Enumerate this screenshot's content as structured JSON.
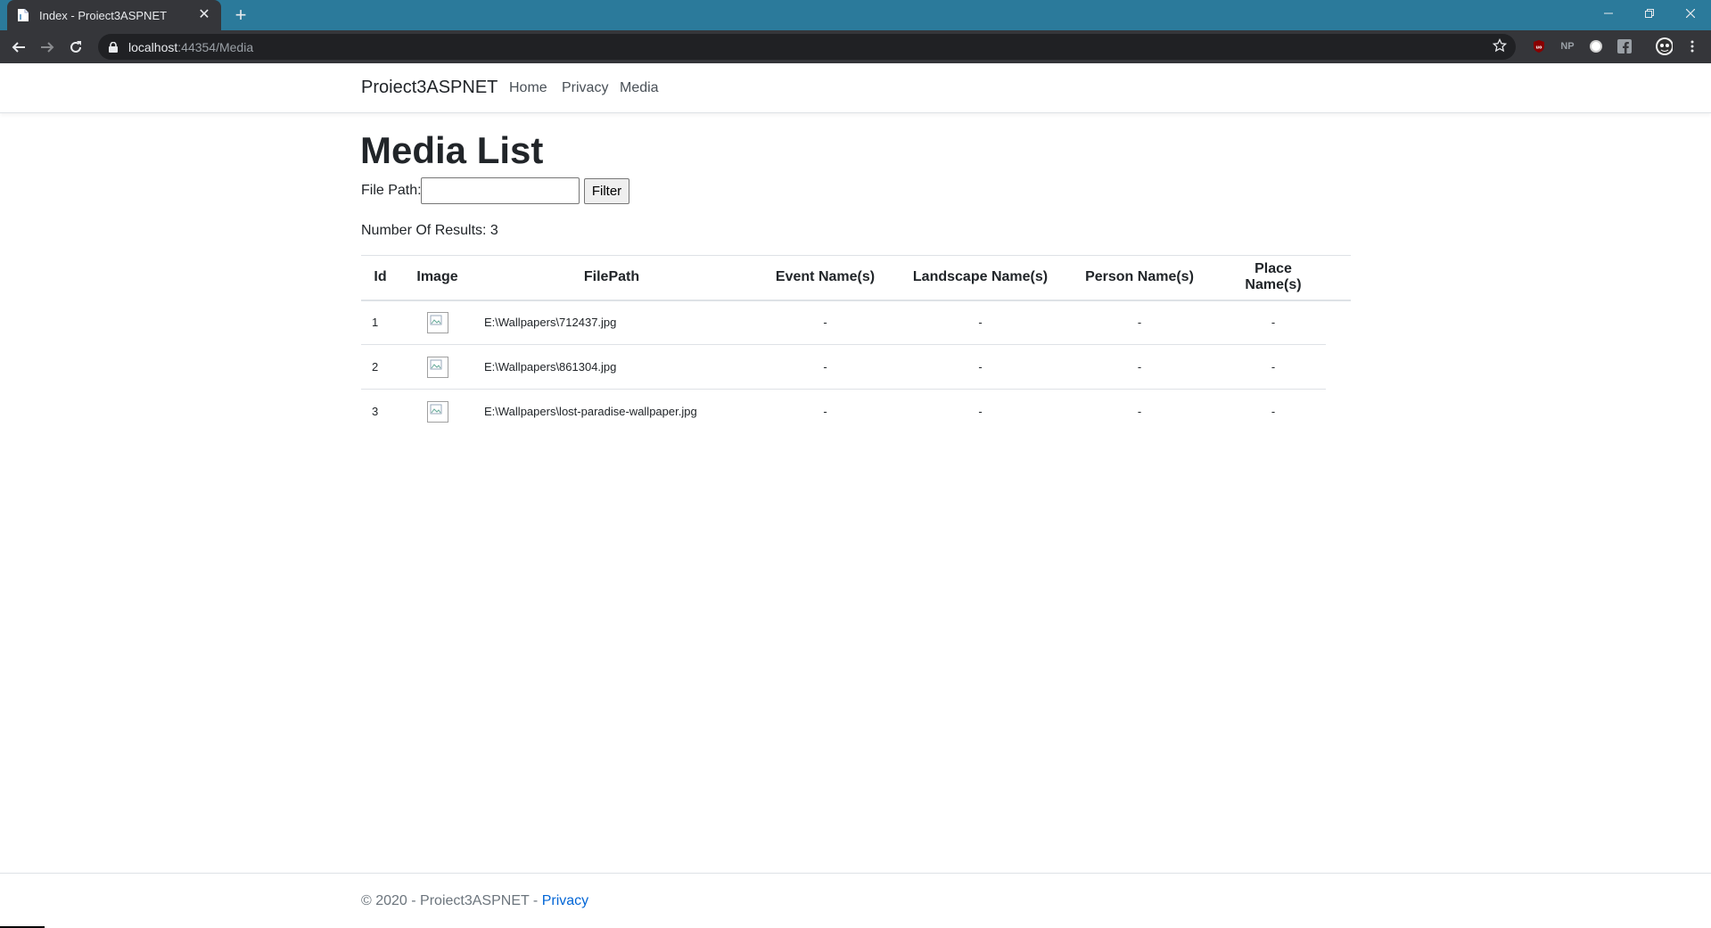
{
  "browser": {
    "tab_title": "Index - Proiect3ASPNET",
    "tab_close": "✕",
    "new_tab": "+",
    "url_host": "localhost",
    "url_rest": ":44354/Media",
    "extensions": [
      "ublock-icon",
      "np-icon",
      "circle-extension-icon",
      "facebook-icon",
      "profile-avatar"
    ],
    "ext_np_label": "NP"
  },
  "site": {
    "brand": "Proiect3ASPNET",
    "nav": [
      "Home",
      "Privacy",
      "Media"
    ]
  },
  "main": {
    "title": "Media List",
    "filter_label": "File Path:",
    "filter_value": "",
    "filter_button": "Filter",
    "results_text": "Number Of Results: 3"
  },
  "table": {
    "headers": [
      "Id",
      "Image",
      "FilePath",
      "Event Name(s)",
      "Landscape Name(s)",
      "Person Name(s)",
      "Place Name(s)"
    ],
    "rows": [
      {
        "id": "1",
        "path": "E:\\Wallpapers\\712437.jpg",
        "event": "-",
        "landscape": "-",
        "person": "-",
        "place": "-"
      },
      {
        "id": "2",
        "path": "E:\\Wallpapers\\861304.jpg",
        "event": "-",
        "landscape": "-",
        "person": "-",
        "place": "-"
      },
      {
        "id": "3",
        "path": "E:\\Wallpapers\\lost-paradise-wallpaper.jpg",
        "event": "-",
        "landscape": "-",
        "person": "-",
        "place": "-"
      }
    ]
  },
  "footer": {
    "text": "© 2020 - Proiect3ASPNET - ",
    "link": "Privacy"
  }
}
